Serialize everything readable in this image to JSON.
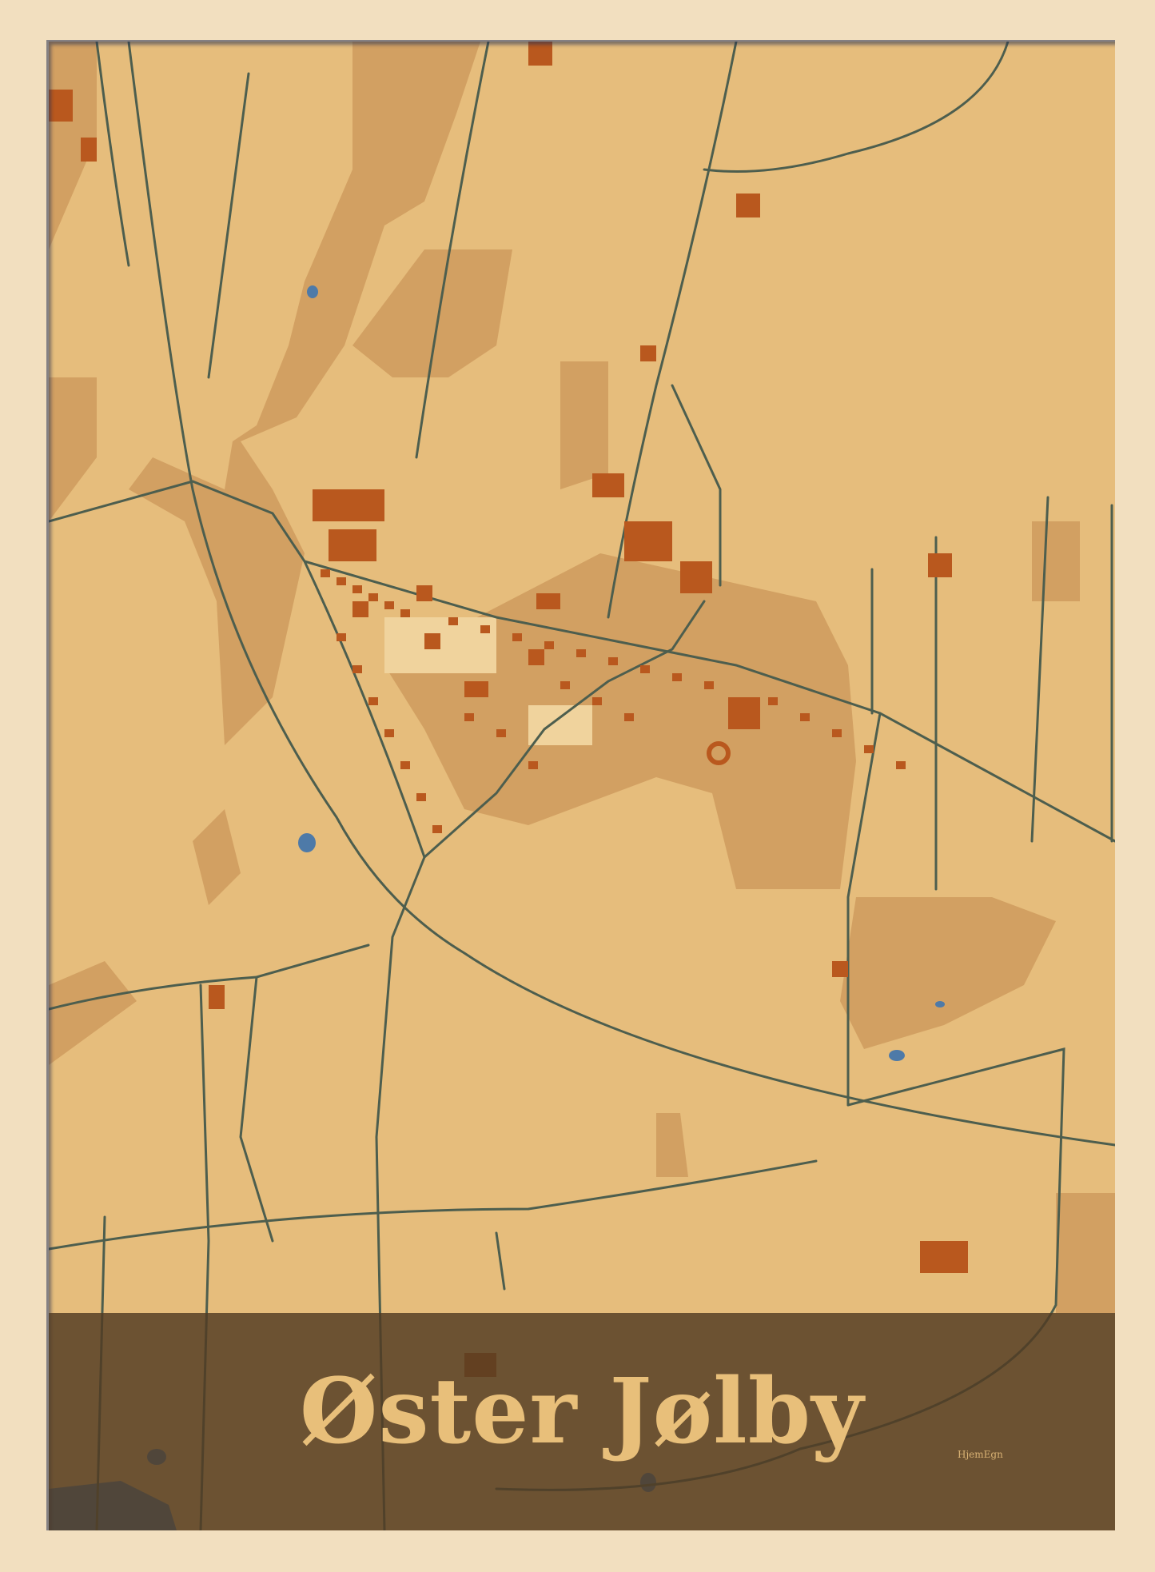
{
  "poster": {
    "title": "Øster Jølby",
    "brand": "HjemEgn"
  },
  "colors": {
    "frame": "#f2dfbf",
    "land": "#e6bd7c",
    "fields": "#d2a062",
    "buildings": "#b9581e",
    "roads": "#4d5e4e",
    "water": "#4e7aa8",
    "band": "#503a22",
    "title_text": "#e8bf7a"
  }
}
